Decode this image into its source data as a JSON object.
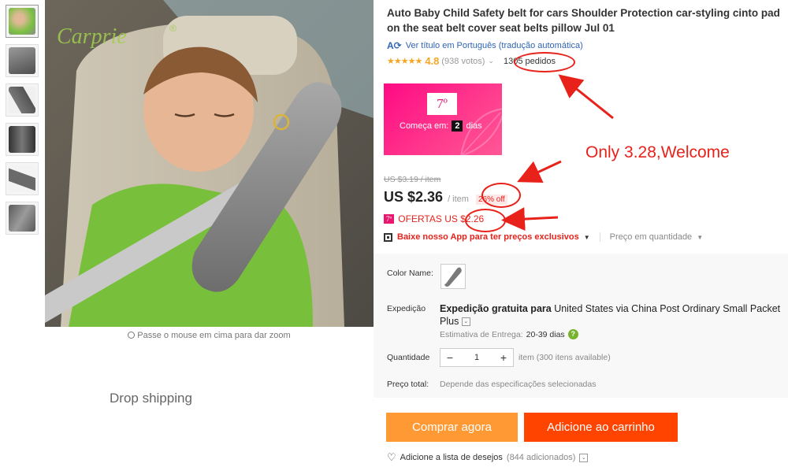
{
  "gallery": {
    "thumbnails": [
      "thumb-1",
      "thumb-2",
      "thumb-3",
      "thumb-4",
      "thumb-5",
      "thumb-6"
    ],
    "watermark": "Carprie",
    "zoom_hint": "Passe o mouse em cima para dar zoom",
    "drop_shipping": "Drop shipping"
  },
  "product": {
    "title": "Auto Baby Child Safety belt for cars Shoulder Protection car-styling cinto pad on the seat belt cover seat belts pillow Jul 01",
    "translate_link": "Ver título em Português (tradução automática)",
    "stars": "★★★★★",
    "rating": "4.8",
    "votes": "(938 votos)",
    "orders": "1305 pedidos"
  },
  "promo": {
    "badge": "7º",
    "starts_in_label": "Começa em:",
    "days_count": "2",
    "days_label": "dias"
  },
  "annotation": {
    "text": "Only 3.28,Welcome"
  },
  "pricing": {
    "old_price": "US $3.19 / item",
    "price": "US $2.36",
    "per_item": "/ item",
    "discount": "26% off",
    "offer_badge": "7º",
    "offer_text": "OFERTAS US $2.26",
    "app_offer": "Baixe nosso App para ter preços exclusivos",
    "qty_price": "Preço em quantidade"
  },
  "attributes": {
    "color_label": "Color Name:",
    "shipping_label": "Expedição",
    "shipping_free": "Expedição gratuita para",
    "shipping_dest": "United States via China Post Ordinary Small Packet Plus",
    "estimate_label": "Estimativa de Entrega:",
    "estimate_days": "20-39 dias",
    "quantity_label": "Quantidade",
    "quantity_value": "1",
    "stock": "item (300 itens available)",
    "total_label": "Preço total:",
    "total_desc": "Depende das especificações selecionadas"
  },
  "actions": {
    "buy_now": "Comprar agora",
    "add_cart": "Adicione ao carrinho",
    "wishlist": "Adicione a lista de desejos",
    "wishlist_count": "(844 adicionados)"
  },
  "colors": {
    "accent_red": "#e8221b",
    "buy_orange": "#ff9933",
    "cart_orange": "#ff4400",
    "promo_pink": "#ff0a84",
    "link_blue": "#2f64b5",
    "star_gold": "#f5a623"
  }
}
